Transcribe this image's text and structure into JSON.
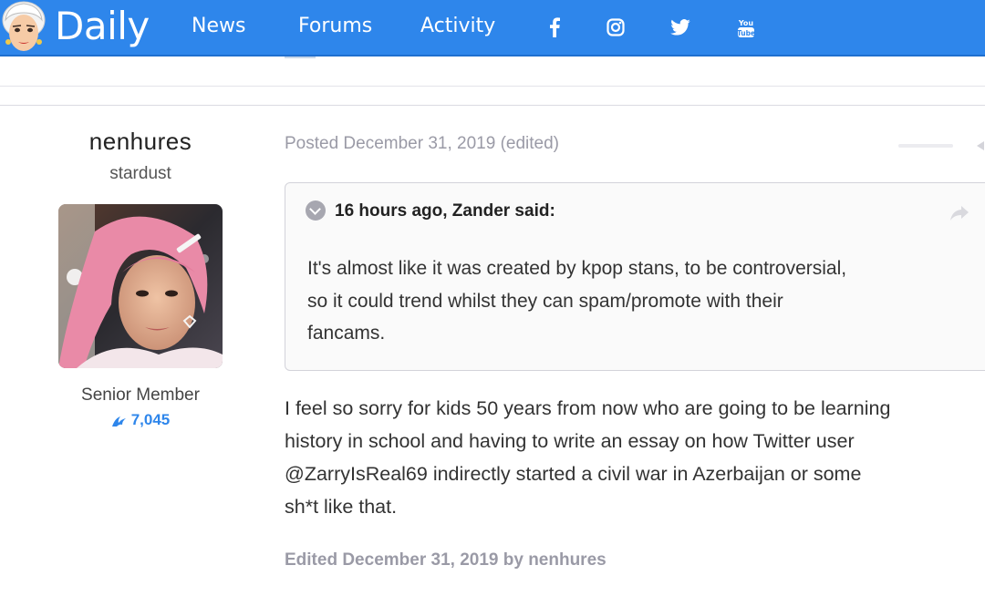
{
  "header": {
    "site_name": "Daily",
    "nav": [
      "News",
      "Forums",
      "Activity"
    ],
    "social_icons": [
      "facebook-icon",
      "instagram-icon",
      "twitter-icon",
      "youtube-icon"
    ],
    "brand_color": "#2e86eb"
  },
  "author": {
    "name": "nenhures",
    "title": "stardust",
    "rank": "Senior Member",
    "reputation": "7,045"
  },
  "post": {
    "meta": "Posted December 31, 2019 (edited)",
    "quote": {
      "citation": "16 hours ago, Zander said:",
      "lines": [
        "It's almost like it was created by kpop stans, to be controversial,",
        "so it could trend whilst they can spam/promote with their",
        "fancams."
      ]
    },
    "body_lines": [
      "I feel so sorry for kids 50 years from now who are going to be learning",
      "history in school and having to write an essay on how Twitter user",
      "@ZarryIsReal69 indirectly started a civil war in Azerbaijan or some",
      "sh*t like that."
    ],
    "edited_note": "Edited December 31, 2019 by nenhures"
  }
}
